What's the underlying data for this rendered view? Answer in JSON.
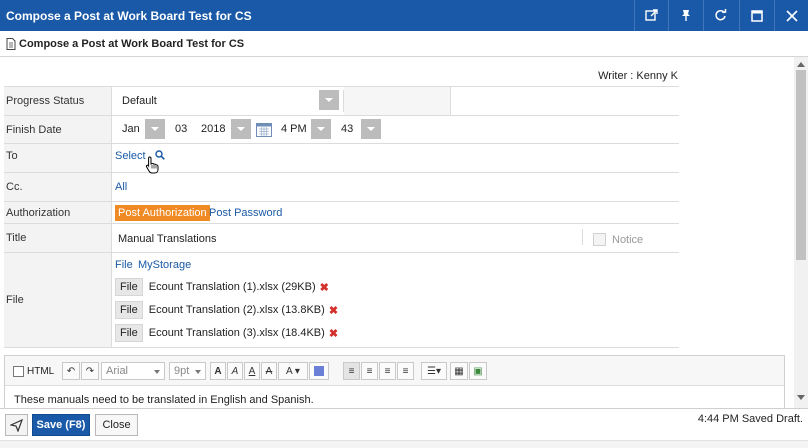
{
  "window": {
    "title": "Compose a Post at Work Board Test for CS",
    "icons": [
      "open-external-icon",
      "pin-icon",
      "refresh-icon",
      "maximize-icon",
      "close-icon"
    ]
  },
  "subheader": {
    "title": "Compose a Post at Work Board Test for CS"
  },
  "writer": "Writer : Kenny K",
  "form": {
    "progress_status": {
      "label": "Progress Status",
      "value": "Default"
    },
    "finish_date": {
      "label": "Finish Date",
      "month": "Jan",
      "day": "03",
      "year": "2018",
      "hour": "4 PM",
      "minute": "43"
    },
    "to": {
      "label": "To",
      "select_link": "Select"
    },
    "cc": {
      "label": "Cc.",
      "value": "All"
    },
    "authorization": {
      "label": "Authorization",
      "post_authorization": "Post Authorization",
      "post_password": "Post Password"
    },
    "title": {
      "label": "Title",
      "value": "Manual Translations",
      "notice_label": "Notice"
    },
    "file": {
      "label": "File",
      "file_link": "File",
      "mystorage_link": "MyStorage",
      "files": [
        {
          "tag": "File",
          "name": "Ecount Translation (1).xlsx (29KB)"
        },
        {
          "tag": "File",
          "name": "Ecount Translation (2).xlsx (13.8KB)"
        },
        {
          "tag": "File",
          "name": "Ecount Translation (3).xlsx (18.4KB)"
        }
      ]
    }
  },
  "editor": {
    "html_label": "HTML",
    "font": "Arial",
    "size": "9pt",
    "body": "These manuals need to be translated in English and Spanish."
  },
  "footer": {
    "save_label": "Save (F8)",
    "close_label": "Close",
    "status": "4:44 PM Saved Draft."
  },
  "colors": {
    "titlebar": "#1a59a8",
    "accent_orange": "#f08a24",
    "link": "#1b5aa5",
    "delete": "#d3312b"
  }
}
